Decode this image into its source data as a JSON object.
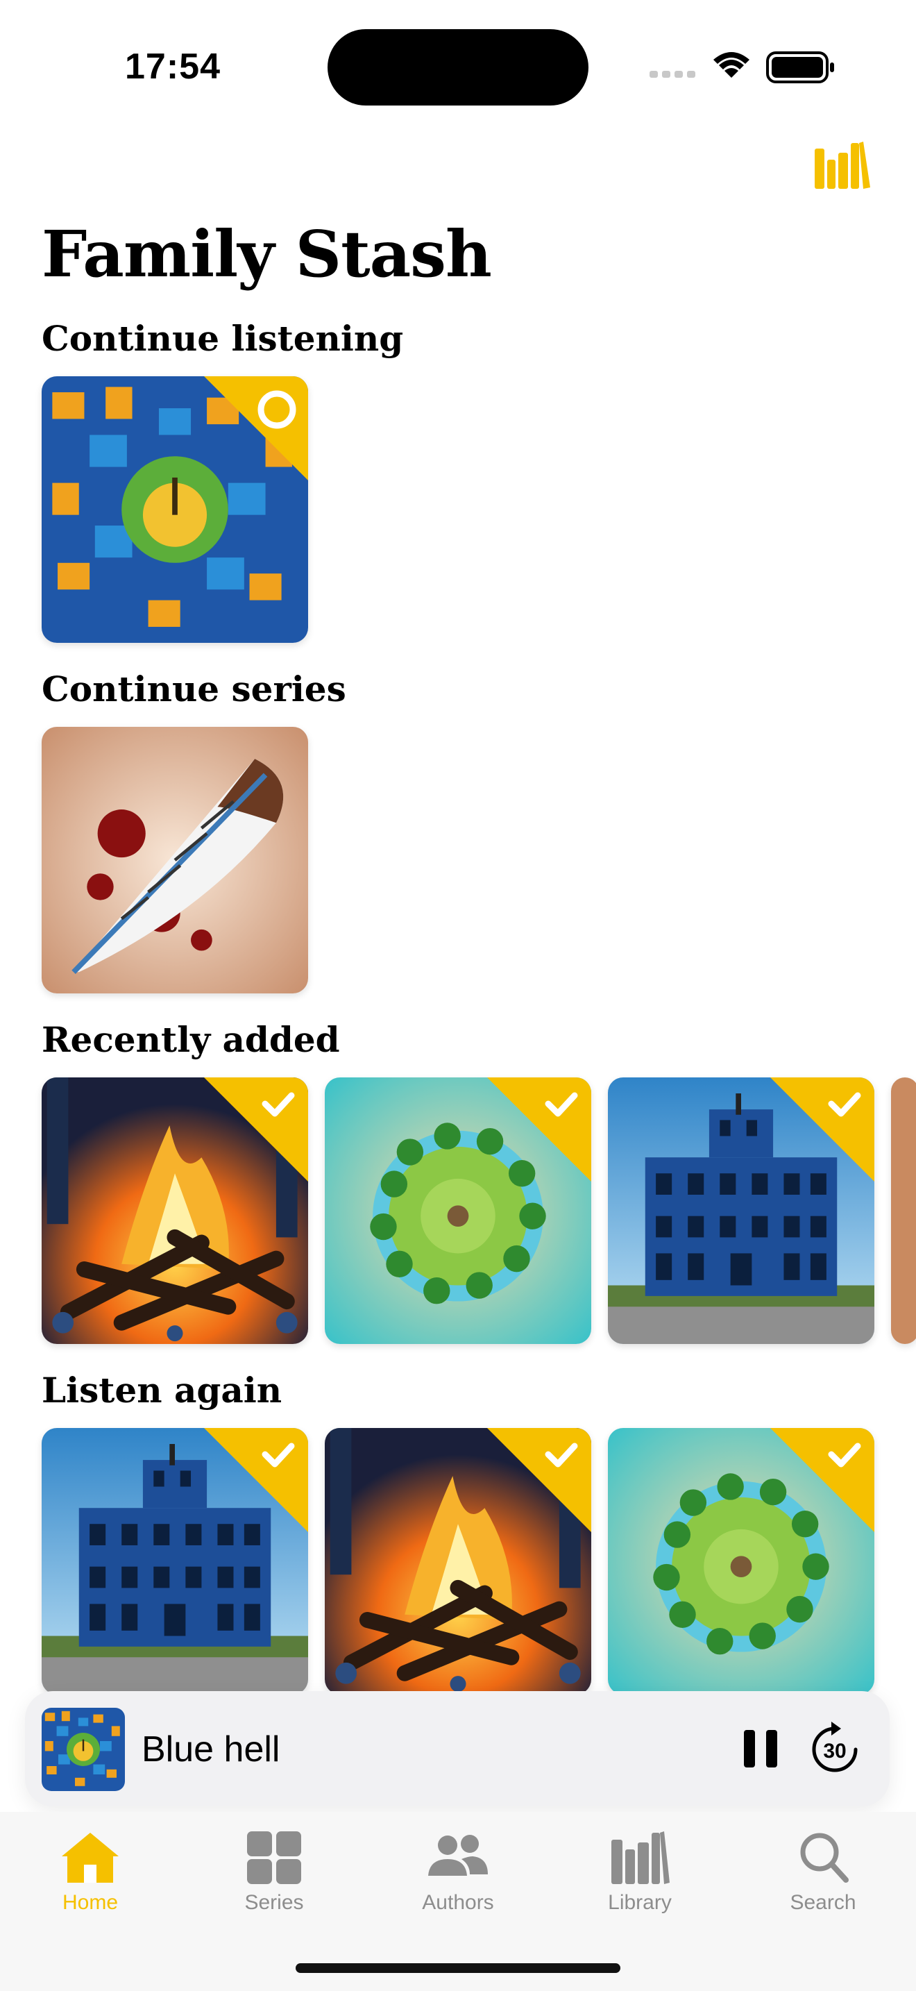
{
  "status_bar": {
    "time": "17:54"
  },
  "header": {
    "title": "Family Stash",
    "library_icon": "books-icon"
  },
  "sections": {
    "continue_listening": {
      "title": "Continue listening"
    },
    "continue_series": {
      "title": "Continue series"
    },
    "recently_added": {
      "title": "Recently added"
    },
    "listen_again": {
      "title": "Listen again"
    }
  },
  "mini_player": {
    "title": "Blue hell",
    "skip_seconds": "30"
  },
  "tabs": [
    {
      "label": "Home",
      "icon": "house-icon",
      "active": true
    },
    {
      "label": "Series",
      "icon": "grid-icon",
      "active": false
    },
    {
      "label": "Authors",
      "icon": "people-icon",
      "active": false
    },
    {
      "label": "Library",
      "icon": "books-icon",
      "active": false
    },
    {
      "label": "Search",
      "icon": "magnifier-icon",
      "active": false
    }
  ],
  "colors": {
    "accent": "#f5c000",
    "inactive": "#8d8d8d"
  }
}
